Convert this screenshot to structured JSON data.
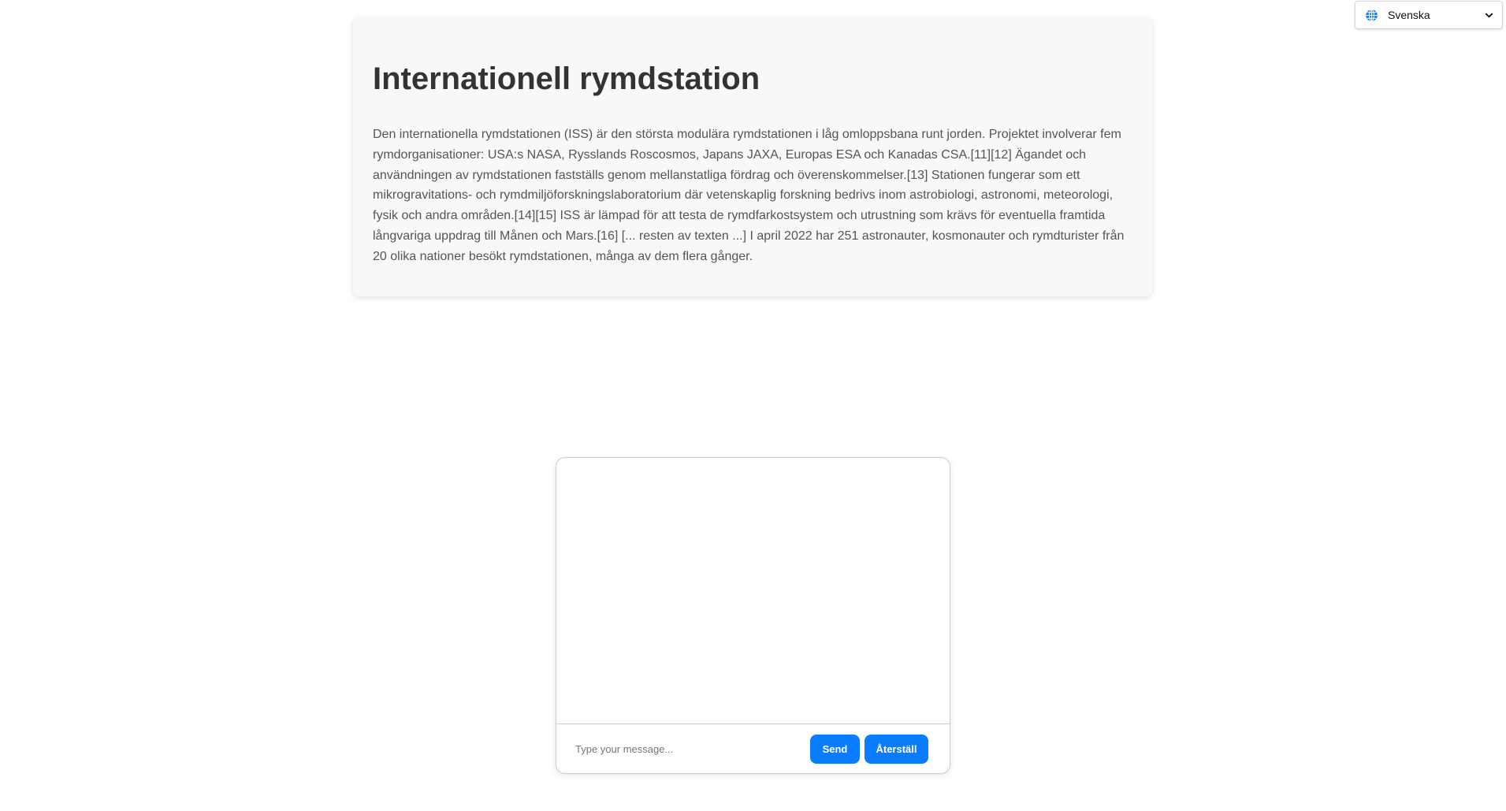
{
  "language_selector": {
    "icon": "globe-icon",
    "selected": "Svenska",
    "chevron_icon": "chevron-down-icon",
    "accent_color": "#1a73e8"
  },
  "article": {
    "title": "Internationell rymdstation",
    "body": "Den internationella rymdstationen (ISS) är den största modulära rymdstationen i låg omloppsbana runt jorden. Projektet involverar fem rymdorganisationer: USA:s NASA, Rysslands Roscosmos, Japans JAXA, Europas ESA och Kanadas CSA.[11][12] Ägandet och användningen av rymdstationen fastställs genom mellanstatliga fördrag och överenskommelser.[13] Stationen fungerar som ett mikrogravitations- och rymdmiljöforskningslaboratorium där vetenskaplig forskning bedrivs inom astrobiologi, astronomi, meteorologi, fysik och andra områden.[14][15] ISS är lämpad för att testa de rymdfarkostsystem och utrustning som krävs för eventuella framtida långvariga uppdrag till Månen och Mars.[16] [... resten av texten ...] I april 2022 har 251 astronauter, kosmonauter och rymdturister från 20 olika nationer besökt rymdstationen, många av dem flera gånger."
  },
  "chat": {
    "input_value": "",
    "input_placeholder": "Type your message...",
    "send_label": "Send",
    "reset_label": "Återställ",
    "button_color": "#0a7cff"
  }
}
